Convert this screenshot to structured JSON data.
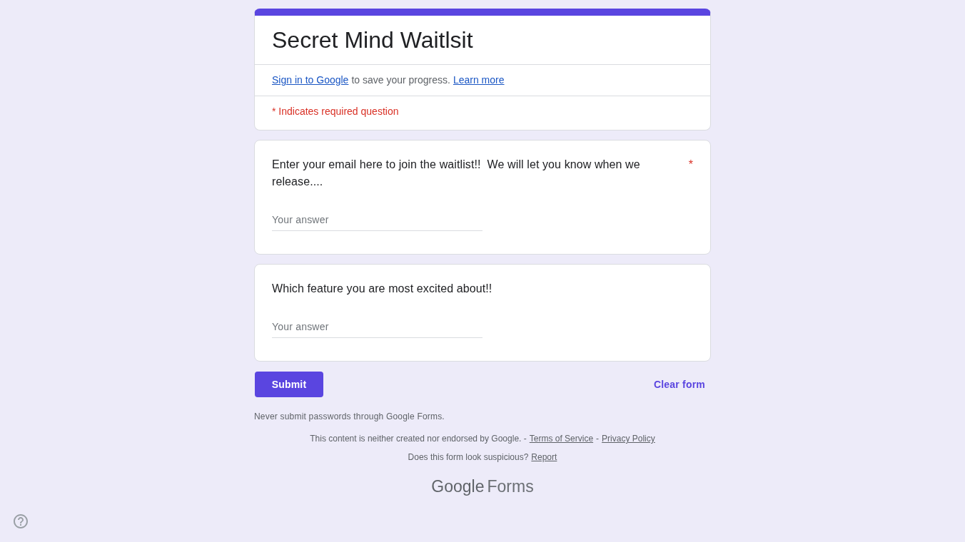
{
  "header": {
    "title": "Secret Mind Waitlsit",
    "signin_notice": [
      {
        "kind": "link",
        "text": "Sign in to Google"
      },
      {
        "kind": "text",
        "text": "to save your progress."
      },
      {
        "kind": "link",
        "text": "Learn more"
      }
    ],
    "required_note": "* Indicates required question"
  },
  "questions": [
    {
      "label": "Enter your email here to join the waitlist!!  We will let you know when we release....",
      "required_mark": "*",
      "placeholder": "Your answer"
    },
    {
      "label": "Which feature you are most excited about!!",
      "placeholder": "Your answer"
    }
  ],
  "actions": {
    "submit": "Submit",
    "clear": "Clear form"
  },
  "footer": {
    "warning": "Never submit passwords through Google Forms.",
    "notices": [
      [
        {
          "kind": "text",
          "text": "This content is neither created nor endorsed by Google. -"
        },
        {
          "kind": "link",
          "text": "Terms of Service"
        },
        {
          "kind": "text",
          "text": "-"
        },
        {
          "kind": "link",
          "text": "Privacy Policy"
        }
      ],
      [
        {
          "kind": "text",
          "text": "Does this form look suspicious?"
        },
        {
          "kind": "link",
          "text": "Report"
        }
      ]
    ],
    "logo": {
      "brand": "Google",
      "product": "Forms"
    }
  }
}
